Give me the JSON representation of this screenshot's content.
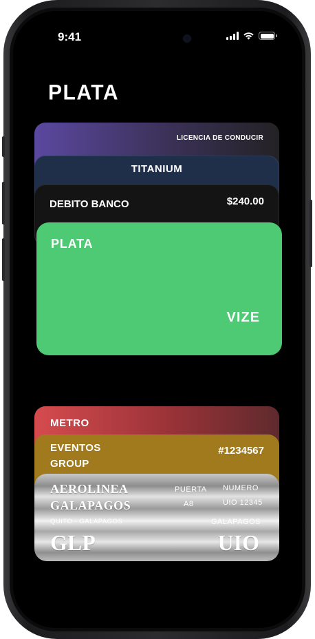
{
  "status_bar": {
    "time": "9:41"
  },
  "page": {
    "title": "PLATA"
  },
  "cards": {
    "licencia": {
      "label": "LICENCIA DE CONDUCIR"
    },
    "titanium": {
      "label": "TITANIUM"
    },
    "debito": {
      "label": "DEBITO BANCO",
      "amount": "$240.00"
    },
    "plata": {
      "name": "PLATA",
      "brand": "VIZE"
    },
    "metro": {
      "label": "METRO"
    },
    "eventos": {
      "line1": "EVENTOS",
      "line2": "GROUP",
      "number": "#1234567"
    },
    "aerolinea": {
      "name_line1": "AEROLINEA",
      "name_line2": "GALAPAGOS",
      "gate_label": "PUERTA",
      "gate_value": "A8",
      "number_label": "NUMERO",
      "number_value": "UIO 12345",
      "route": "QUITO - GALAPAGOS",
      "dest_label": "GALAPAGOS",
      "origin_code": "GLP",
      "dest_code": "UIO"
    }
  },
  "colors": {
    "plata_green": "#4ec974",
    "titanium_blue": "#1f2e49",
    "metro_red": "#d54b4e",
    "eventos_gold": "#a07a1d",
    "licencia_purple": "#5b48a0"
  },
  "icons": [
    "cellular-signal-icon",
    "wifi-icon",
    "battery-icon"
  ]
}
